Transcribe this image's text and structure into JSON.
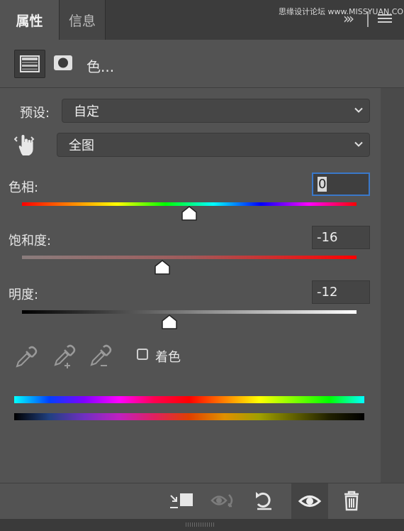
{
  "tabs": [
    {
      "label": "属性",
      "active": true
    },
    {
      "label": "信息",
      "active": false
    }
  ],
  "watermark": "思缘设计论坛 www.MISSYUAN.COM",
  "header": {
    "title": "色...",
    "icons": [
      "hue-saturation-adjustment-icon",
      "layer-mask-icon"
    ]
  },
  "preset": {
    "label": "预设:",
    "value": "自定"
  },
  "range": {
    "value": "全图"
  },
  "sliders": {
    "hue": {
      "label": "色相:",
      "value": "0",
      "level": 0.5
    },
    "saturation": {
      "label": "饱和度:",
      "value": "-16",
      "level": 0.42
    },
    "lightness": {
      "label": "明度:",
      "value": "-12",
      "level": 0.44
    }
  },
  "colorize": {
    "label": "着色",
    "checked": false
  },
  "footer_icons": [
    "clip-to-layer-icon",
    "view-previous-state-icon",
    "reset-icon",
    "visibility-eye-icon",
    "trash-icon"
  ],
  "colors": {
    "panel_bg": "#535353",
    "tab_bar_bg": "#3c3c3c",
    "focus_border": "#3a78c9"
  }
}
